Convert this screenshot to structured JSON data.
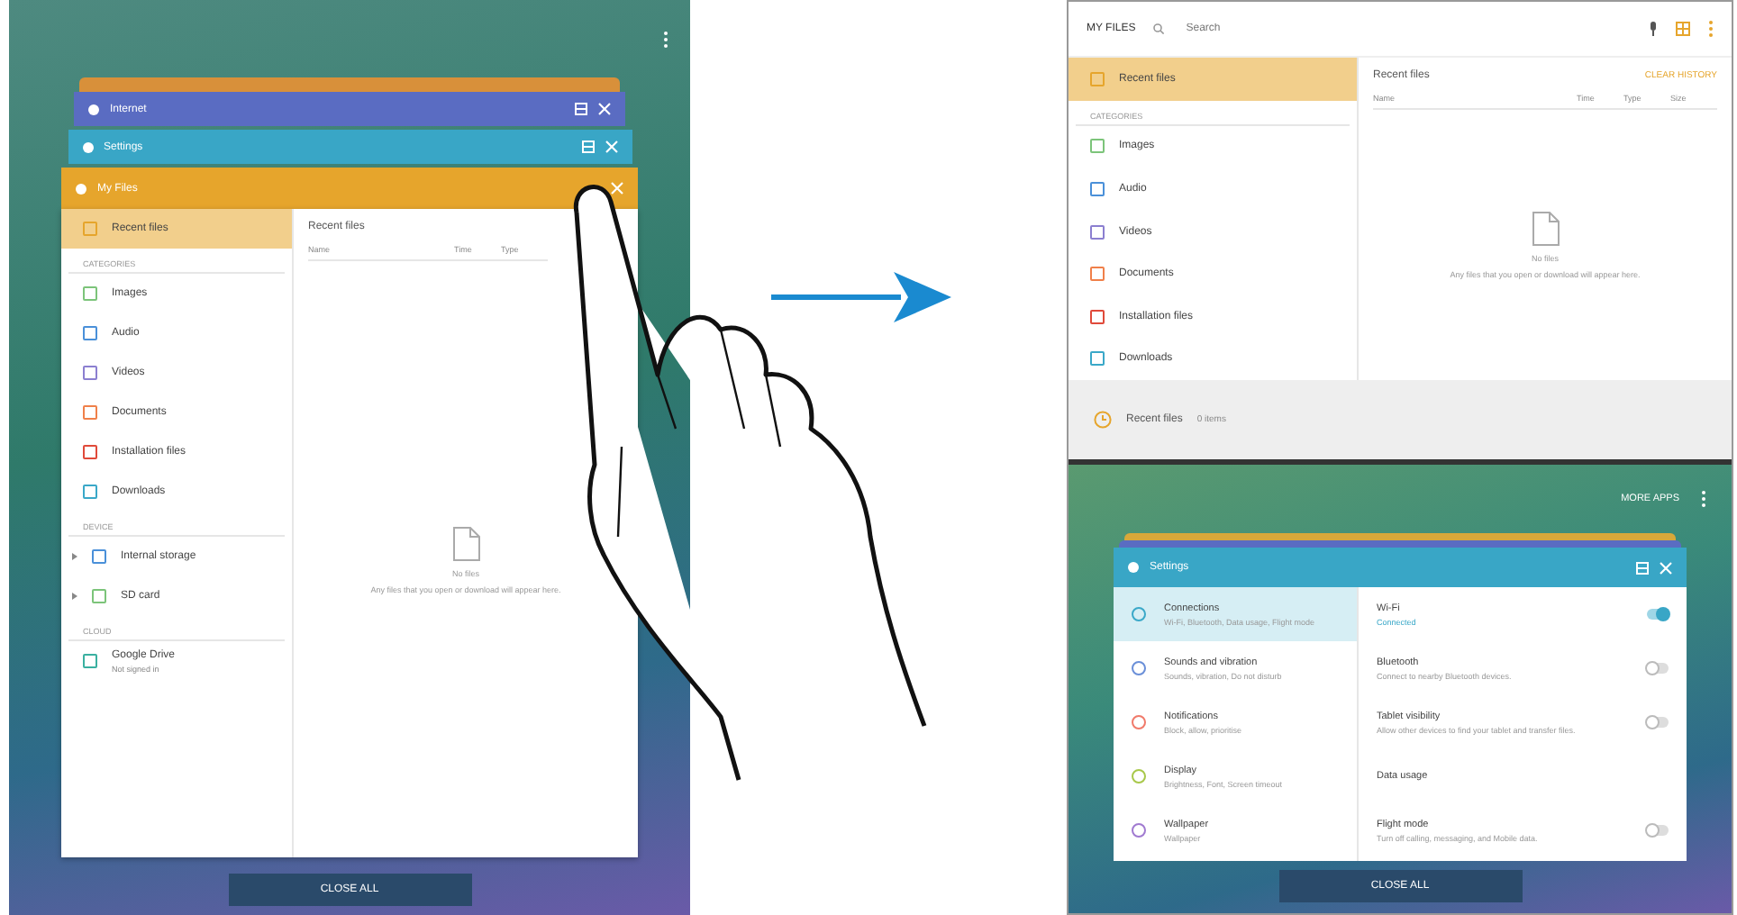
{
  "left_screen": {
    "windows": [
      {
        "title": "Internet",
        "color": "#5a6cc2"
      },
      {
        "title": "Settings",
        "color": "#39a6c6"
      },
      {
        "title": "My Files",
        "color": "#e6a52c"
      }
    ],
    "sidebar": [
      {
        "kind": "item",
        "label": "Recent files",
        "selected": true,
        "color": "#e6a52c"
      },
      {
        "kind": "section",
        "label": "CATEGORIES"
      },
      {
        "kind": "item",
        "label": "Images",
        "selected": false,
        "color": "#7cc47a"
      },
      {
        "kind": "item",
        "label": "Audio",
        "selected": false,
        "color": "#4a90d9"
      },
      {
        "kind": "item",
        "label": "Videos",
        "selected": false,
        "color": "#8b7fd0"
      },
      {
        "kind": "item",
        "label": "Documents",
        "selected": false,
        "color": "#f0804a"
      },
      {
        "kind": "item",
        "label": "Installation files",
        "selected": false,
        "color": "#e04a3a"
      },
      {
        "kind": "item",
        "label": "Downloads",
        "selected": false,
        "color": "#3aa8c8"
      },
      {
        "kind": "section",
        "label": "DEVICE"
      },
      {
        "kind": "storage",
        "label": "Internal storage",
        "selected": false,
        "color": "#4a90d9"
      },
      {
        "kind": "storage",
        "label": "SD card",
        "selected": false,
        "color": "#7cc47a"
      },
      {
        "kind": "section",
        "label": "CLOUD"
      },
      {
        "kind": "cloud",
        "label": "Google Drive",
        "subtitle": "Not signed in",
        "selected": false,
        "color": "#3ab0a0"
      }
    ],
    "content": {
      "title": "Recent files",
      "columns": [
        "Name",
        "Time",
        "Type"
      ],
      "empty_title": "No files",
      "empty_message": "Any files that you open or download will appear here."
    },
    "close_all": "CLOSE ALL"
  },
  "right_screen": {
    "my_files": {
      "title": "MY FILES",
      "search": {
        "placeholder": "Search"
      },
      "sidebar": [
        {
          "kind": "item",
          "label": "Recent files",
          "selected": true,
          "color": "#e6a52c"
        },
        {
          "kind": "section",
          "label": "CATEGORIES"
        },
        {
          "kind": "item",
          "label": "Images",
          "selected": false,
          "color": "#7cc47a"
        },
        {
          "kind": "item",
          "label": "Audio",
          "selected": false,
          "color": "#4a90d9"
        },
        {
          "kind": "item",
          "label": "Videos",
          "selected": false,
          "color": "#8b7fd0"
        },
        {
          "kind": "item",
          "label": "Documents",
          "selected": false,
          "color": "#f0804a"
        },
        {
          "kind": "item",
          "label": "Installation files",
          "selected": false,
          "color": "#e04a3a"
        },
        {
          "kind": "item",
          "label": "Downloads",
          "selected": false,
          "color": "#3aa8c8"
        }
      ],
      "content": {
        "title": "Recent files",
        "action": "CLEAR HISTORY",
        "columns": [
          "Name",
          "Time",
          "Type",
          "Size"
        ],
        "empty_title": "No files",
        "empty_message": "Any files that you open or download will appear here."
      },
      "bottom_bar": {
        "label": "Recent files",
        "count": "0 items"
      }
    },
    "more_apps": "MORE APPS",
    "settings": {
      "title": "Settings",
      "categories": [
        {
          "label": "Connections",
          "subtitle": "Wi-Fi, Bluetooth, Data usage, Flight mode",
          "selected": true,
          "color": "#3aa8c8"
        },
        {
          "label": "Sounds and vibration",
          "subtitle": "Sounds, vibration, Do not disturb",
          "selected": false,
          "color": "#6a8fd8"
        },
        {
          "label": "Notifications",
          "subtitle": "Block, allow, prioritise",
          "selected": false,
          "color": "#f07a6a"
        },
        {
          "label": "Display",
          "subtitle": "Brightness, Font, Screen timeout",
          "selected": false,
          "color": "#a8c84a"
        },
        {
          "label": "Wallpaper",
          "subtitle": "Wallpaper",
          "selected": false,
          "color": "#a07ad0"
        }
      ],
      "options": [
        {
          "kind": "toggle",
          "title": "Wi-Fi",
          "subtitle": "Connected",
          "on": true
        },
        {
          "kind": "toggle",
          "title": "Bluetooth",
          "subtitle": "Connect to nearby Bluetooth devices.",
          "on": false
        },
        {
          "kind": "toggle",
          "title": "Tablet visibility",
          "subtitle": "Allow other devices to find your tablet and transfer files.",
          "on": false
        },
        {
          "kind": "plain",
          "title": "Data usage"
        },
        {
          "kind": "toggle",
          "title": "Flight mode",
          "subtitle": "Turn off calling, messaging, and Mobile data.",
          "on": false
        }
      ]
    },
    "close_all": "CLOSE ALL"
  }
}
